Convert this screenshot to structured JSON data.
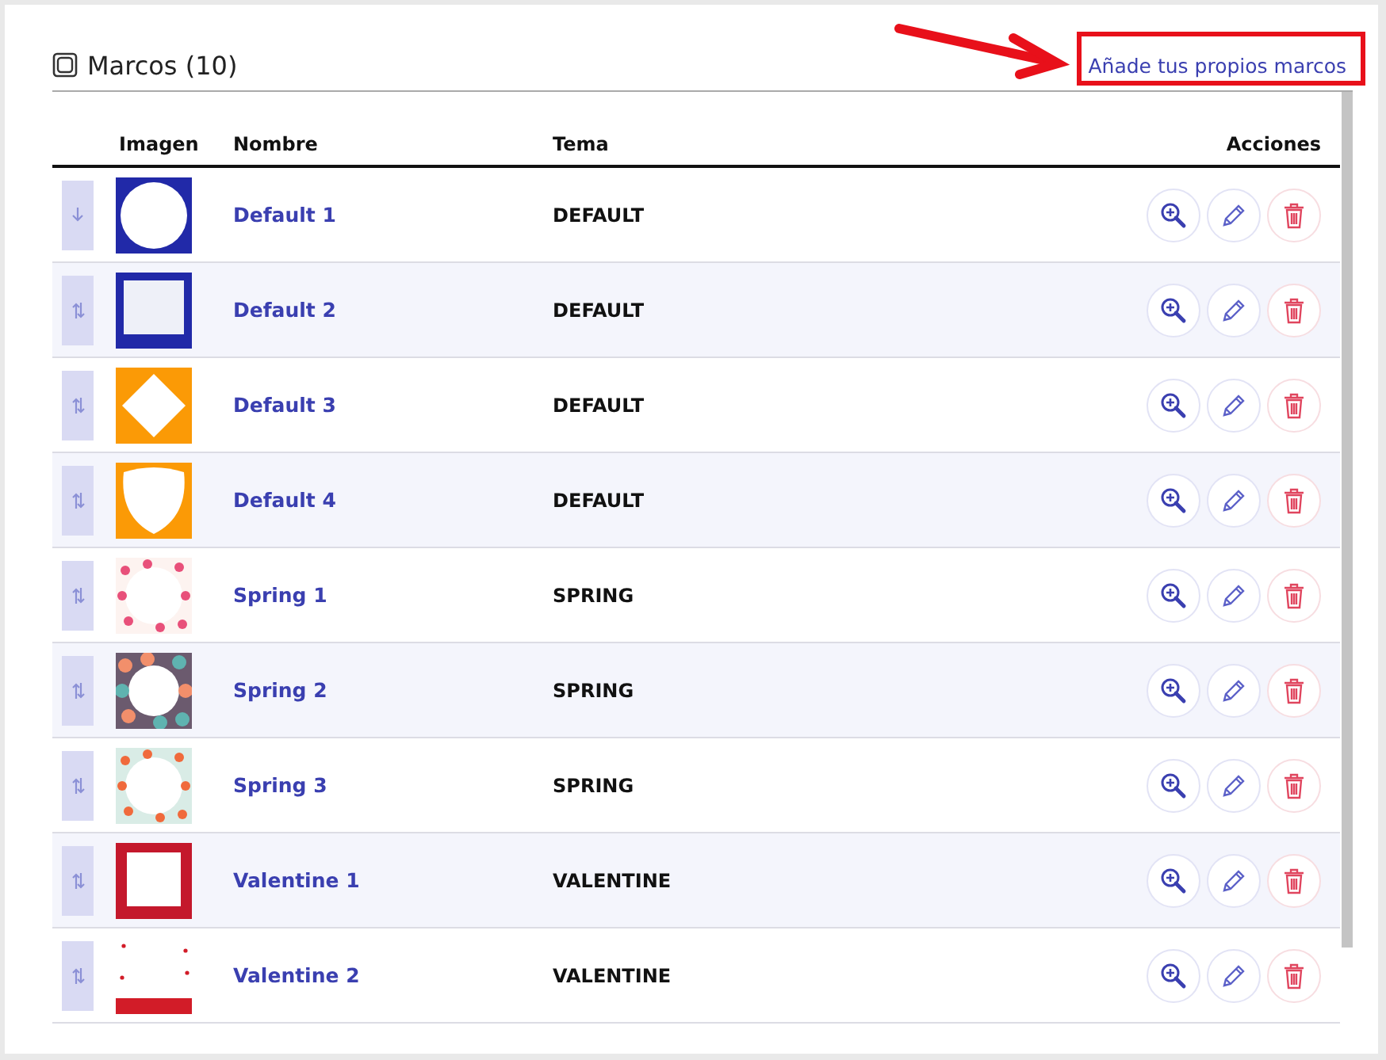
{
  "header": {
    "title": "Marcos (10)",
    "link": "Añade tus propios marcos"
  },
  "table": {
    "columns": [
      "Imagen",
      "Nombre",
      "Tema",
      "Acciones"
    ],
    "rows": [
      {
        "handle": {
          "kind": "down"
        },
        "thumbnail": {
          "kind": "circle"
        },
        "name": "Default 1",
        "theme": "DEFAULT"
      },
      {
        "handle": {
          "kind": "both"
        },
        "thumbnail": {
          "kind": "square"
        },
        "name": "Default 2",
        "theme": "DEFAULT"
      },
      {
        "handle": {
          "kind": "both"
        },
        "thumbnail": {
          "kind": "diamond"
        },
        "name": "Default 3",
        "theme": "DEFAULT"
      },
      {
        "handle": {
          "kind": "both"
        },
        "thumbnail": {
          "kind": "shield"
        },
        "name": "Default 4",
        "theme": "DEFAULT"
      },
      {
        "handle": {
          "kind": "both"
        },
        "thumbnail": {
          "kind": "spring1"
        },
        "name": "Spring 1",
        "theme": "SPRING"
      },
      {
        "handle": {
          "kind": "both"
        },
        "thumbnail": {
          "kind": "spring2"
        },
        "name": "Spring 2",
        "theme": "SPRING"
      },
      {
        "handle": {
          "kind": "both"
        },
        "thumbnail": {
          "kind": "spring3"
        },
        "name": "Spring 3",
        "theme": "SPRING"
      },
      {
        "handle": {
          "kind": "both"
        },
        "thumbnail": {
          "kind": "valentine1"
        },
        "name": "Valentine 1",
        "theme": "VALENTINE"
      },
      {
        "handle": {
          "kind": "both"
        },
        "thumbnail": {
          "kind": "valentine2"
        },
        "name": "Valentine 2",
        "theme": "VALENTINE"
      }
    ]
  }
}
